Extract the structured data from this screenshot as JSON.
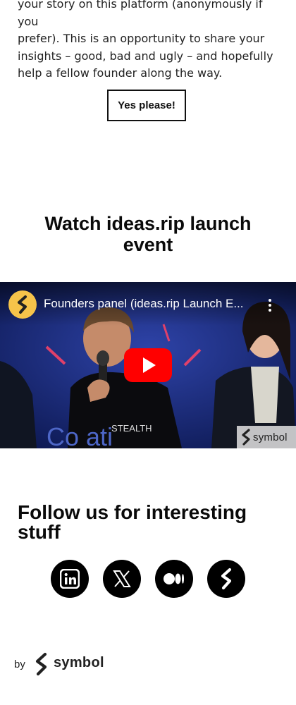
{
  "intro": {
    "lines": [
      "your story on this platform (anonymously if you",
      "prefer). This is an opportunity to share your",
      "insights – good, bad and ugly – and hopefully",
      "help a fellow founder along the way."
    ]
  },
  "cta": {
    "label": "Yes please!"
  },
  "watch": {
    "title": "Watch ideas.rip launch event"
  },
  "video": {
    "title": "Founders panel (ideas.rip Launch E...",
    "watermark": "symbol",
    "shirt_text": "STEALTH",
    "backdrop_text": "Co  ati"
  },
  "follow": {
    "title": "Follow us for interesting stuff",
    "icons": [
      "linkedin-icon",
      "x-icon",
      "medium-icon",
      "symbol-icon"
    ]
  },
  "footer": {
    "by": "by",
    "brand": "symbol"
  },
  "colors": {
    "play_red": "#ff0000",
    "channel_yellow": "#f6c34a",
    "video_blue": "#1b2d7a"
  }
}
